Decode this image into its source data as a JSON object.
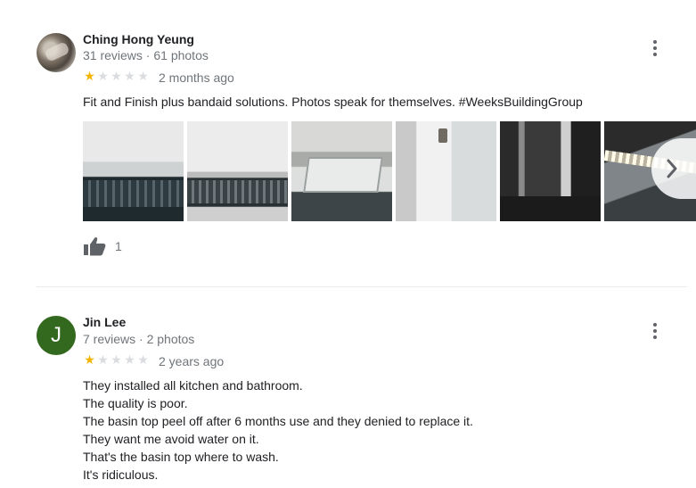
{
  "reviews": [
    {
      "name": "Ching Hong Yeung",
      "meta": "31 reviews · 61 photos",
      "rating": 1,
      "date": "2 months ago",
      "text": "Fit and Finish plus bandaid solutions. Photos speak for themselves. #WeeksBuildingGroup",
      "likes": "1"
    },
    {
      "name": "Jin Lee",
      "avatar_letter": "J",
      "avatar_color": "#33691e",
      "meta": "7 reviews · 2 photos",
      "rating": 1,
      "date": "2 years ago",
      "text_lines": [
        "They installed all kitchen and bathroom.",
        "The quality is poor.",
        "The basin top peel off after 6 months use and they denied to replace it.",
        "They want me avoid water on it.",
        "That's the basin top where to wash.",
        "It's ridiculous."
      ]
    }
  ],
  "colors": {
    "star_filled": "#f4b400",
    "star_empty": "#dadce0"
  },
  "icons": [
    "more-vert-icon",
    "thumbs-up-icon",
    "chevron-right-icon",
    "star-icon"
  ]
}
